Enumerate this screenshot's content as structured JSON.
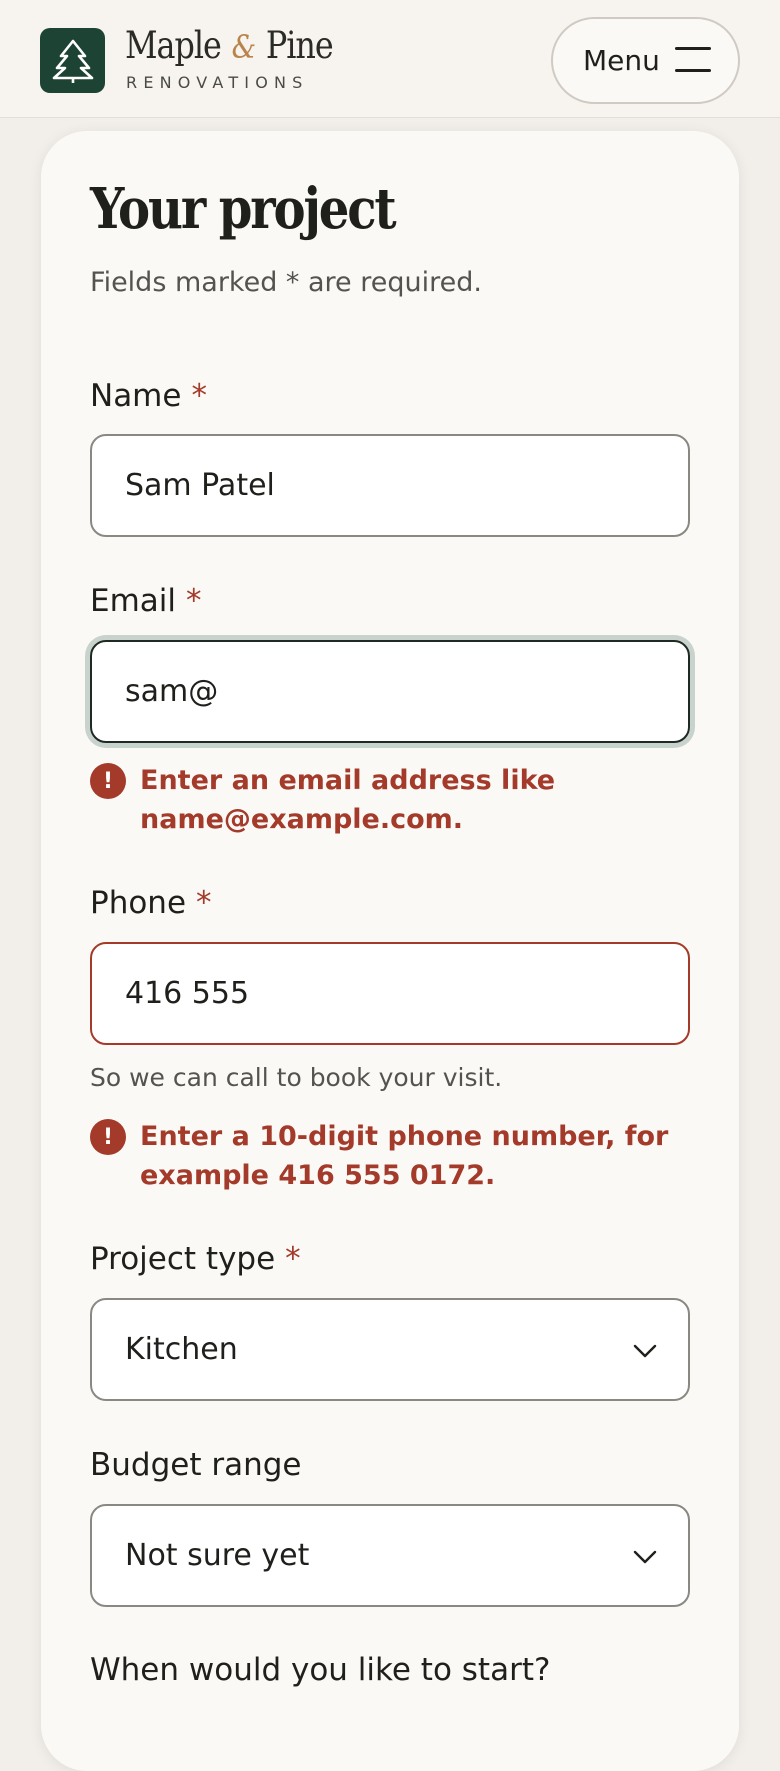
{
  "brand": {
    "name_part1": "Maple",
    "ampersand": "&",
    "name_part2": "Pine",
    "subtitle": "RENOVATIONS",
    "logo_icon": "pine-tree-icon"
  },
  "header": {
    "menu_label": "Menu",
    "menu_icon": "hamburger-icon"
  },
  "form": {
    "title": "Your project",
    "required_note": "Fields marked * are required.",
    "required_marker": "*",
    "name": {
      "label": "Name",
      "value": "Sam Patel"
    },
    "email": {
      "label": "Email",
      "value": "sam@",
      "error": "Enter an email address like name@example.com."
    },
    "phone": {
      "label": "Phone",
      "value": "416 555",
      "hint": "So we can call to book your visit.",
      "error": "Enter a 10-digit phone number, for example 416 555 0172."
    },
    "project_type": {
      "label": "Project type",
      "value": "Kitchen"
    },
    "budget": {
      "label": "Budget range",
      "value": "Not sure yet"
    },
    "start": {
      "label": "When would you like to start?"
    }
  },
  "colors": {
    "brand_green": "#1d4334",
    "accent_copper": "#b8844c",
    "error_red": "#a33a2a",
    "background": "#f2efea"
  }
}
